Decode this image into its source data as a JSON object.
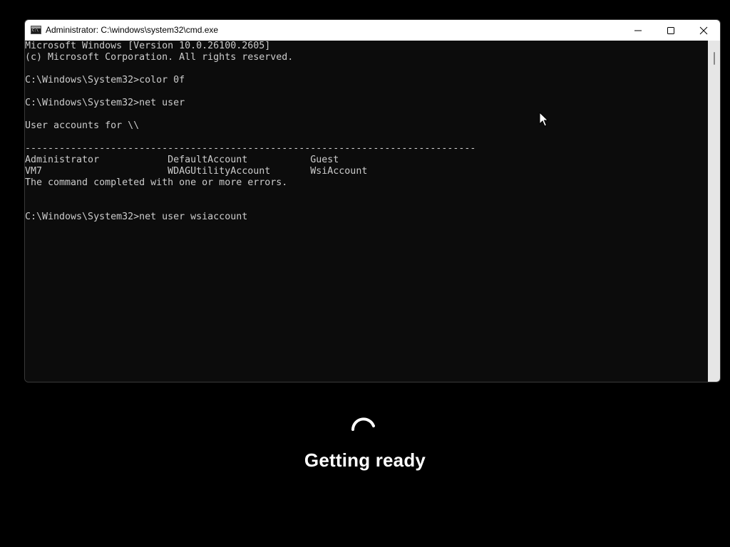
{
  "window": {
    "title": "Administrator: C:\\windows\\system32\\cmd.exe",
    "icon": "cmd-icon",
    "controls": {
      "minimize": "minimize-icon",
      "maximize": "maximize-icon",
      "close": "close-icon"
    }
  },
  "terminal": {
    "lines": [
      "Microsoft Windows [Version 10.0.26100.2605]",
      "(c) Microsoft Corporation. All rights reserved.",
      "",
      "C:\\Windows\\System32>color 0f",
      "",
      "C:\\Windows\\System32>net user",
      "",
      "User accounts for \\\\",
      "",
      "-------------------------------------------------------------------------------",
      "Administrator            DefaultAccount           Guest",
      "VM7                      WDAGUtilityAccount       WsiAccount",
      "The command completed with one or more errors.",
      "",
      "",
      "C:\\Windows\\System32>net user wsiaccount"
    ]
  },
  "overlay": {
    "status_text": "Getting ready",
    "spinner_icon": "loading-spinner-icon"
  },
  "colors": {
    "background": "#000000",
    "terminal_bg": "#0c0c0c",
    "terminal_fg": "#cccccc",
    "titlebar_bg": "#ffffff"
  }
}
